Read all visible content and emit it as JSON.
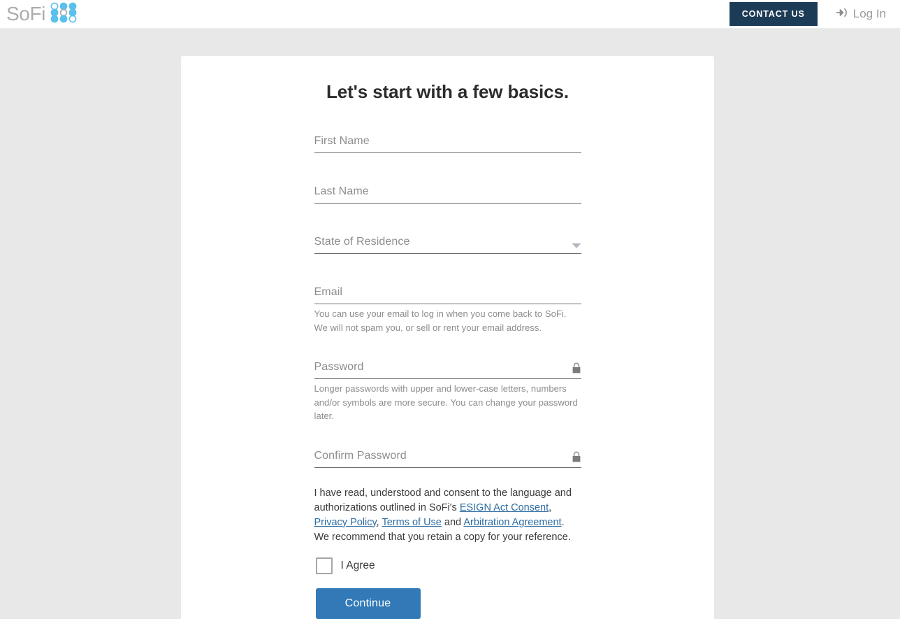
{
  "header": {
    "brand_name": "SoFi",
    "brand_logo_icon": "sofi-dot-grid-logo",
    "contact_label": "CONTACT US",
    "login_label": "Log In",
    "login_icon": "sign-in-arrow-icon",
    "contact_bg_color": "#1c3b57",
    "brand_dot_color": "#5bc0eb"
  },
  "page": {
    "background_color": "#e8e8e8",
    "card_background": "#ffffff",
    "title": "Let's start with a few basics."
  },
  "form": {
    "first_name": {
      "label": "First Name",
      "value": "",
      "placeholder": "First Name"
    },
    "last_name": {
      "label": "Last Name",
      "value": "",
      "placeholder": "Last Name"
    },
    "state": {
      "label": "State of Residence",
      "value": "",
      "caret_icon": "chevron-down-icon"
    },
    "email": {
      "label": "Email",
      "value": "",
      "placeholder": "Email",
      "helper": "You can use your email to log in when you come back to SoFi. We will not spam you, or sell or rent your email address."
    },
    "password": {
      "label": "Password",
      "value": "",
      "placeholder": "Password",
      "lock_icon": "lock-icon",
      "helper": "Longer passwords with upper and lower-case letters, numbers and/or symbols are more secure. You can change your password later."
    },
    "confirm_password": {
      "label": "Confirm Password",
      "value": "",
      "placeholder": "Confirm Password",
      "lock_icon": "lock-icon"
    }
  },
  "consent": {
    "part1": "I have read, understood and consent to the language and authorizations outlined in SoFi's ",
    "link_esign": "ESIGN Act Consent",
    "sep1": ", ",
    "link_privacy": "Privacy Policy",
    "sep2": ", ",
    "link_terms": "Terms of Use",
    "sep3": " and ",
    "link_arbitration": "Arbitration Agreement",
    "part2": ". We recommend that you retain a copy for your reference.",
    "link_color": "#2d6ca2",
    "agree_label": "I Agree",
    "agree_checked": false
  },
  "actions": {
    "continue_label": "Continue",
    "continue_color": "#3279b7"
  }
}
